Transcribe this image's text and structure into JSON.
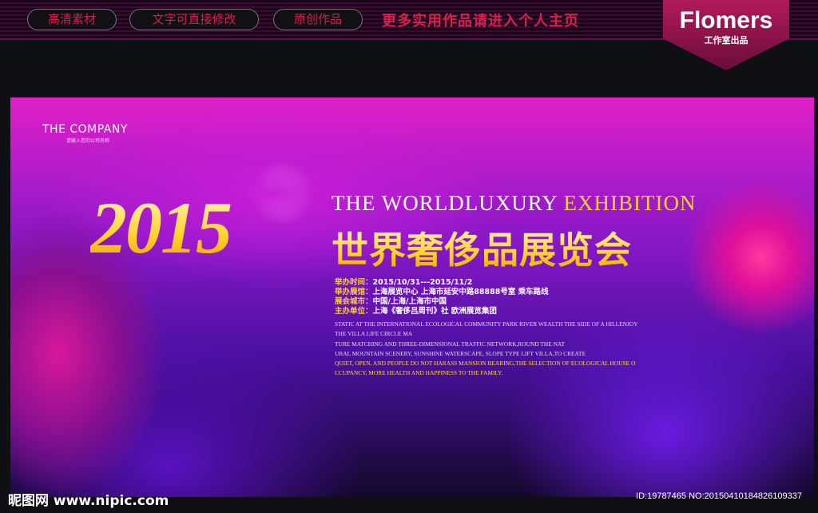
{
  "topbar": {
    "tags": [
      "高清素材",
      "文字可直接修改",
      "原创作品"
    ],
    "promo": "更多实用作品请进入个人主页",
    "badge_title": "Flomers",
    "badge_sub": "工作室出品"
  },
  "banner": {
    "company": "THE COMPANY",
    "company_sub": "请输入您的公司名称",
    "year": "2015",
    "en_title_a": "THE WORLDLUXURY",
    "en_title_b": "EXHIBITION",
    "cn_title": "世界奢侈品展览会",
    "info": [
      {
        "k": "举办时间：",
        "v": "2015/10/31---2015/11/2"
      },
      {
        "k": "举办展馆：",
        "v": "上海展览中心 上海市延安中路88888号室  乘车路线"
      },
      {
        "k": "展会城市：",
        "v": "中国/上海/上海市中国"
      },
      {
        "k": "主办单位：",
        "v": "上海《奢侈吕周刊》社 欧洲展览集团"
      }
    ],
    "desc": [
      "STATIC AT THE INTERNATIONAL ECOLOGICAL COMMUNITY PARK RIVER WEALTH THE SIDE OF A HILLENJOY",
      "THE VILLA LIFE CIRCLE MA",
      "TURE MATCHING AND THREE-DIMENSIONAL TRAFFIC NETWORK,ROUND THE NAT",
      "URAL MOUNTAIN SCENERY, SUNSHINE WATERSCAPE, SLOPE TYPE LIFT VILLA,TO CREATE",
      "QUIET, OPEN, AND PEOPLE DO NOT HARASS MANSION BEARING,THE SELECTION OF ECOLOGICAL HOUSE O",
      "CCUPANCY, MORE HEALTH AND HAPPINESS TO THE FAMILY."
    ]
  },
  "footer": {
    "watermark": "昵图网 www.nipic.com",
    "id": "ID:19787465 NO:20150410184826109337"
  }
}
